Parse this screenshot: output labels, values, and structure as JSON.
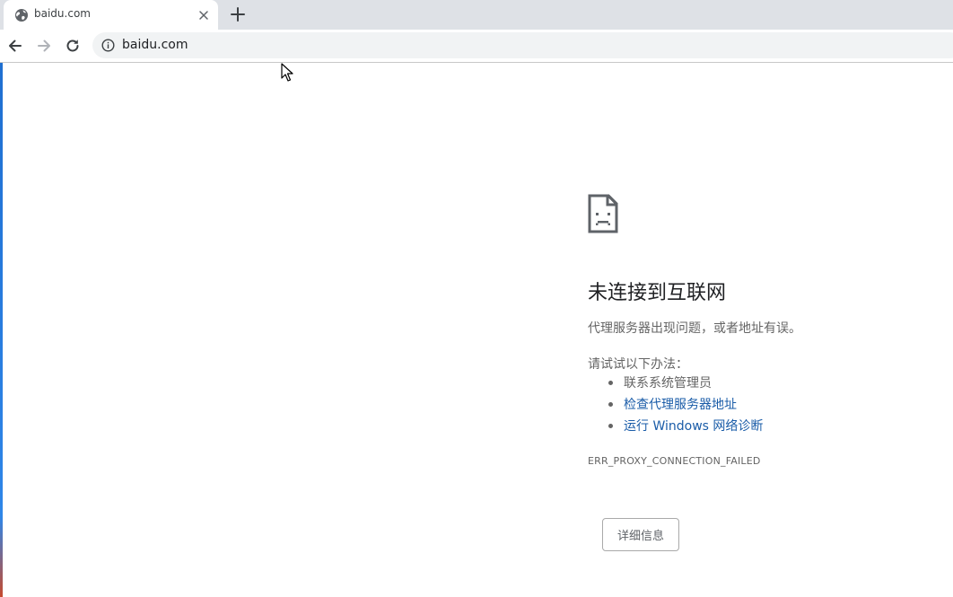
{
  "tab": {
    "title": "baidu.com",
    "favicon": "globe-icon"
  },
  "toolbar": {
    "url": "baidu.com"
  },
  "error": {
    "icon": "sad-document-icon",
    "title": "未连接到互联网",
    "description": "代理服务器出现问题，或者地址有误。",
    "suggestions_heading": "请试试以下办法：",
    "suggestions": [
      {
        "text": "联系系统管理员",
        "is_link": false
      },
      {
        "text": "检查代理服务器地址",
        "is_link": true
      },
      {
        "text": "运行 Windows 网络诊断",
        "is_link": true
      }
    ],
    "code": "ERR_PROXY_CONNECTION_FAILED",
    "details_button": "详细信息"
  },
  "colors": {
    "tabstrip_bg": "#dee1e6",
    "link": "#1a5ca8",
    "secondary_text": "#646464"
  }
}
